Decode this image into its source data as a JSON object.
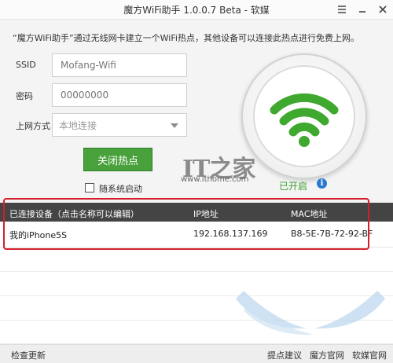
{
  "window": {
    "title": "魔方WiFi助手 1.0.0.7 Beta - 软媒",
    "title_icons": [
      "settings-icon",
      "minimize-icon",
      "close-icon"
    ]
  },
  "description": "“魔方WiFi助手”通过无线网卡建立一个WiFi热点，其他设备可以连接此热点进行免费上网。",
  "form": {
    "ssid_label": "SSID",
    "ssid_placeholder": "Mofang-Wifi",
    "password_label": "密码",
    "password_placeholder": "00000000",
    "method_label": "上网方式",
    "method_value": "本地连接"
  },
  "actions": {
    "close_hotspot": "关闭热点",
    "autostart_label": "随系统启动"
  },
  "watermark": {
    "logo": "IT之家",
    "url": "www.ithome.com"
  },
  "status": {
    "text": "已开启",
    "info_icon": "info-icon",
    "wifi_icon": "wifi-icon"
  },
  "table": {
    "headers": [
      "已连接设备（点击名称可以编辑）",
      "IP地址",
      "MAC地址"
    ],
    "rows": [
      [
        "我的iPhone5S",
        "192.168.137.169",
        "B8-5E-7B-72-92-BF"
      ]
    ]
  },
  "footer": {
    "check_update": "检查更新",
    "feedback": "提点建议",
    "magic_site": "魔方官网",
    "ruanmei_site": "软媒官网"
  },
  "colors": {
    "accent_green": "#48a13b",
    "header_dark": "#444444",
    "highlight_red": "#d21f2b"
  }
}
